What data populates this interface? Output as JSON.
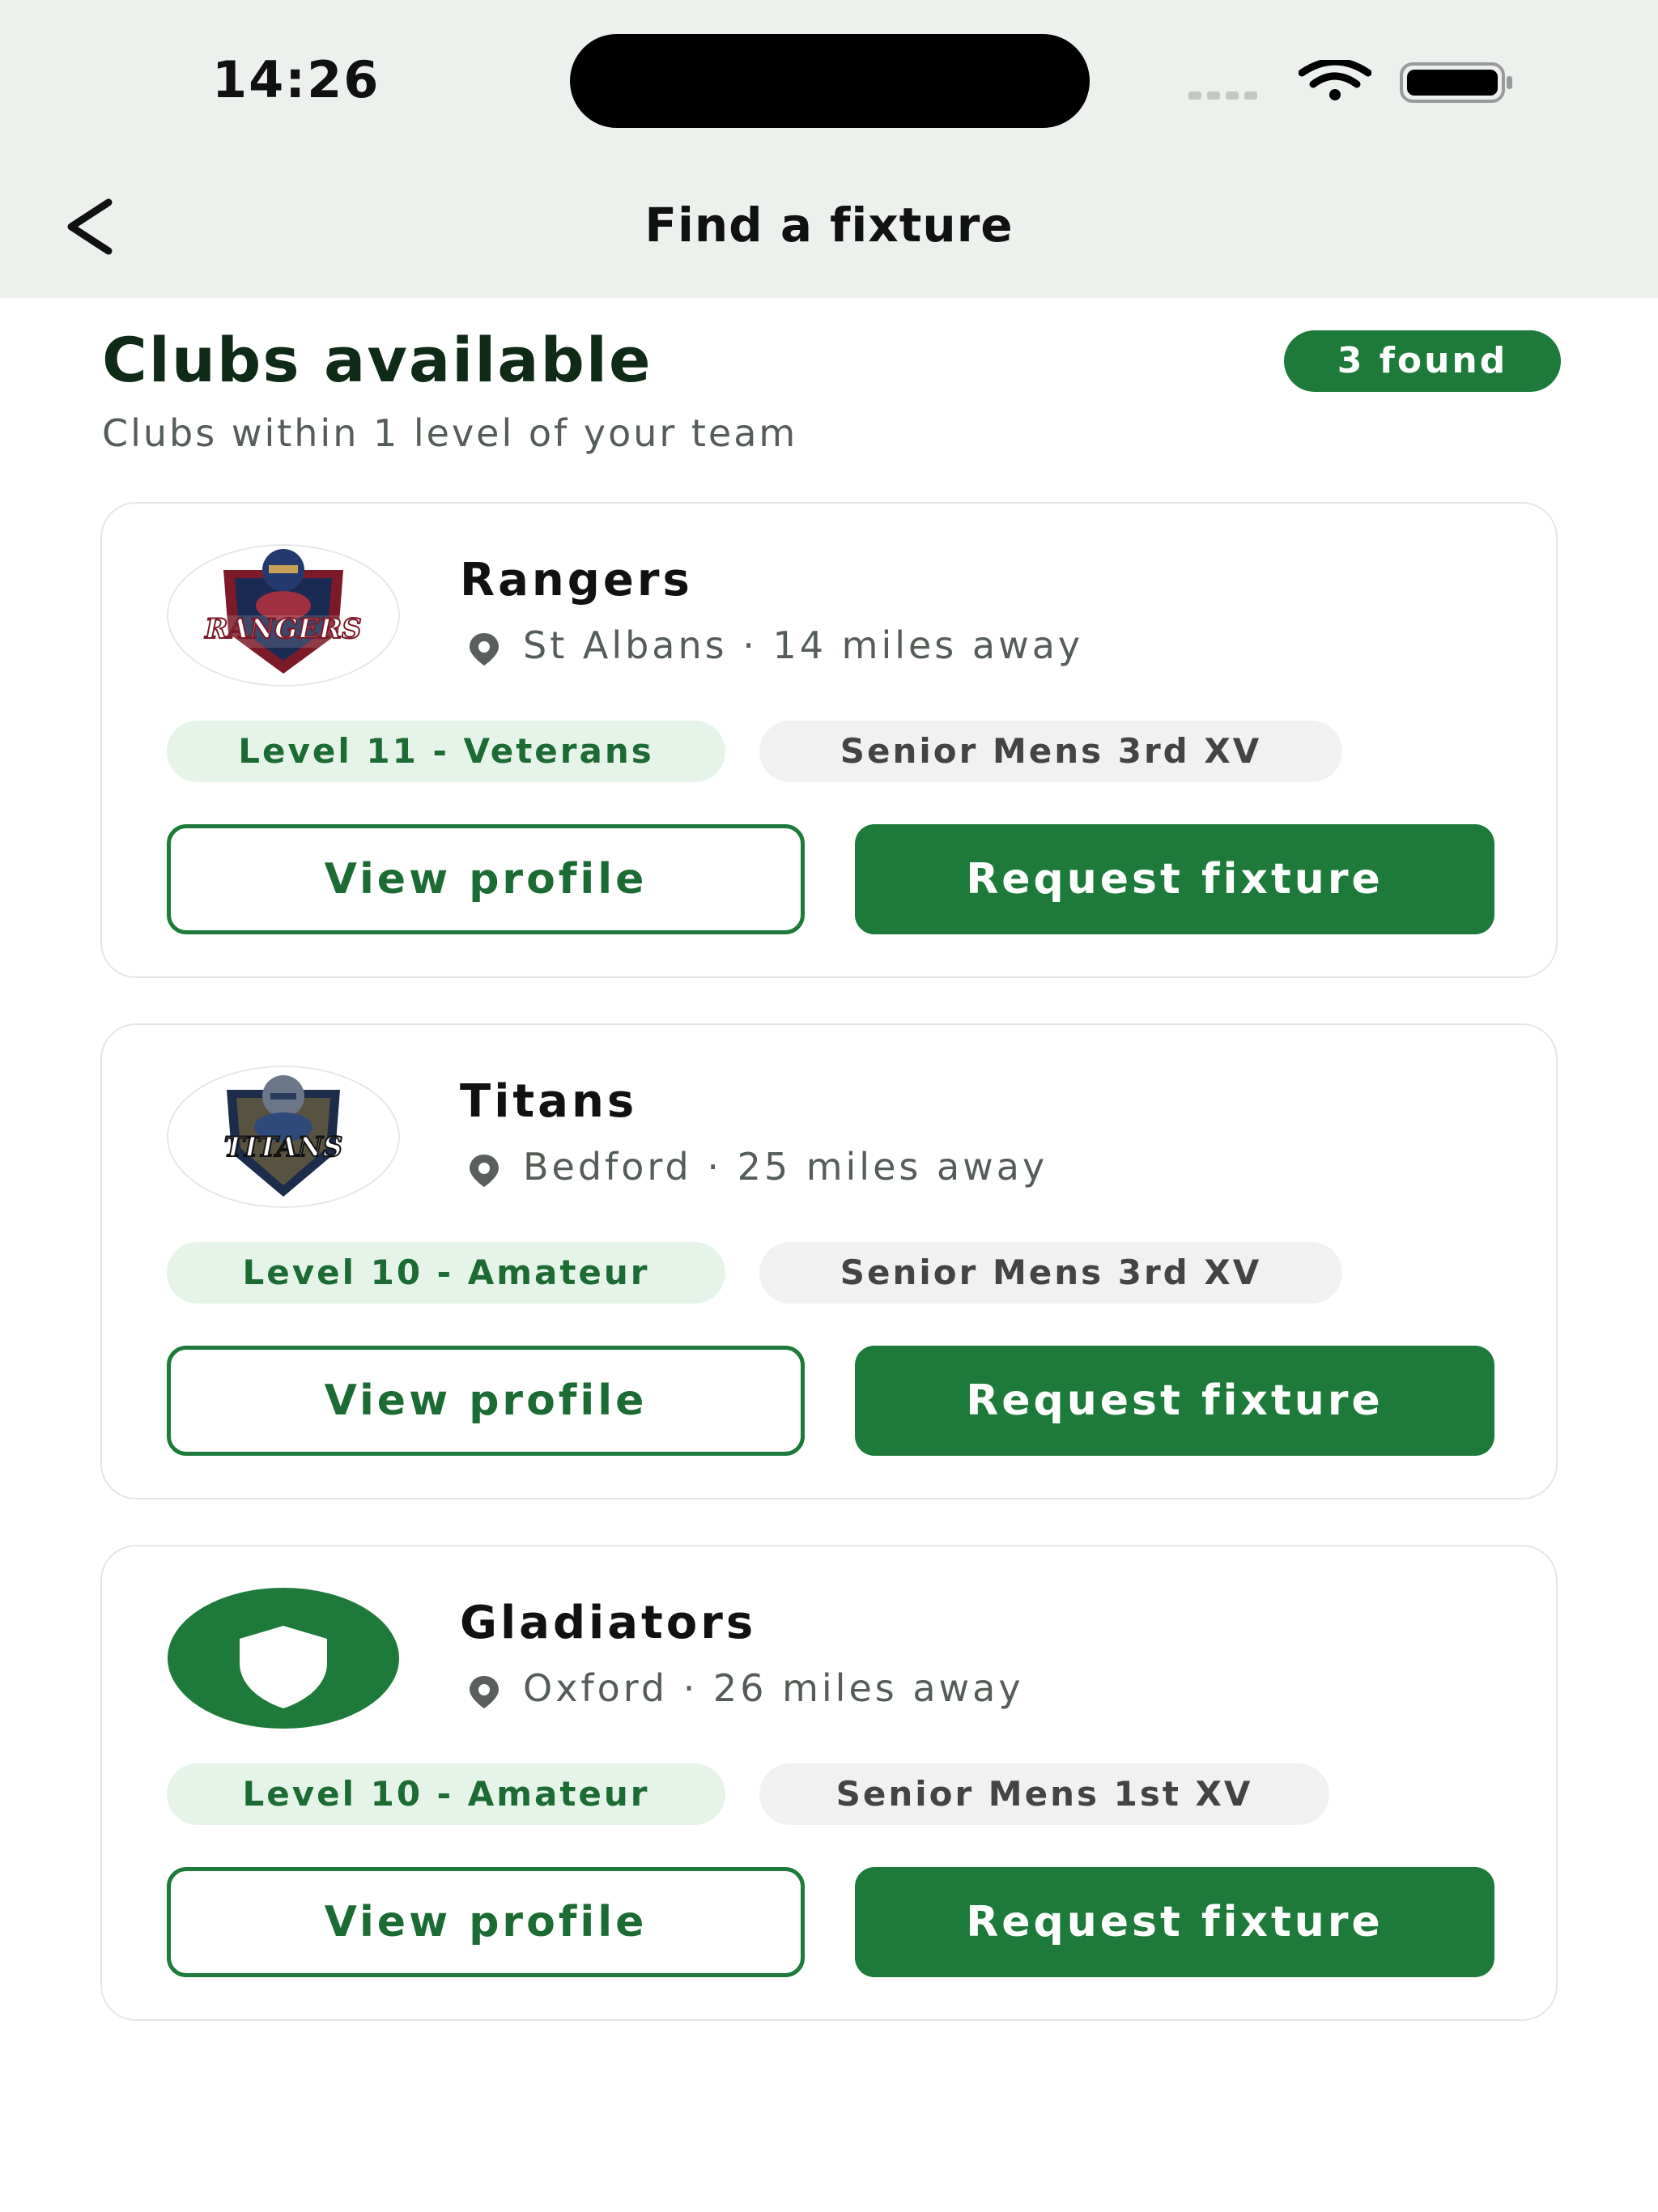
{
  "status": {
    "time": "14:26"
  },
  "nav": {
    "title": "Find a fixture"
  },
  "section": {
    "title": "Clubs available",
    "subtitle": "Clubs within 1 level of your team",
    "found_badge": "3 found"
  },
  "clubs": [
    {
      "name": "Rangers",
      "location": "St Albans · 14 miles away",
      "level": "Level 11 - Veterans",
      "team": "Senior Mens 3rd XV",
      "logo_text": "RANGERS",
      "view_label": "View profile",
      "request_label": "Request fixture"
    },
    {
      "name": "Titans",
      "location": "Bedford · 25 miles away",
      "level": "Level 10 - Amateur",
      "team": "Senior Mens 3rd XV",
      "logo_text": "TITANS",
      "view_label": "View profile",
      "request_label": "Request fixture"
    },
    {
      "name": "Gladiators",
      "location": "Oxford · 26 miles away",
      "level": "Level 10 - Amateur",
      "team": "Senior Mens 1st XV",
      "view_label": "View profile",
      "request_label": "Request fixture"
    }
  ],
  "colors": {
    "accent": "#1d7a3a",
    "level_chip_bg": "#e6f3e8",
    "header_bg": "#edf1ed"
  }
}
